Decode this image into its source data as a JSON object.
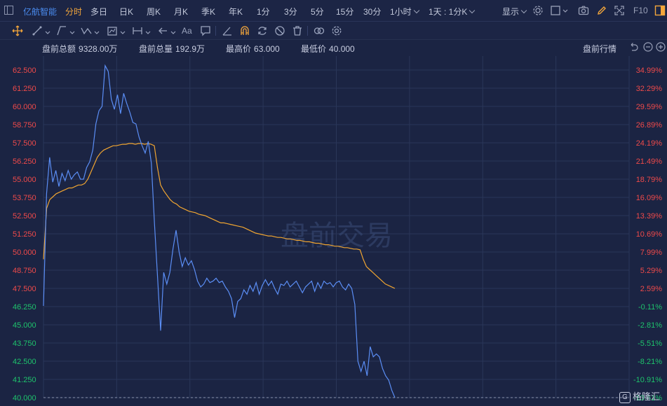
{
  "topbar": {
    "stock_name": "亿航智能",
    "periods": [
      "分时",
      "多日",
      "日K",
      "周K",
      "月K",
      "季K",
      "年K",
      "1分",
      "3分",
      "5分",
      "15分",
      "30分",
      "1小时",
      "1天 : 1分K"
    ],
    "active_period": "分时",
    "display_label": "显示",
    "f10_label": "F10"
  },
  "toolbar": {
    "text_tool_label": "Aa"
  },
  "infobar": {
    "turnover_label": "盘前总额",
    "turnover_value": "9328.00万",
    "volume_label": "盘前总量",
    "volume_value": "192.9万",
    "high_label": "最高价",
    "high_value": "63.000",
    "low_label": "最低价",
    "low_value": "40.000",
    "mode_label": "盘前行情"
  },
  "watermark": "盘前交易",
  "logo": {
    "mark": "G",
    "text": "格隆汇"
  },
  "colors": {
    "price_line": "#5b8ef5",
    "avg_line": "#f0a531",
    "up": "#ef4a4a",
    "down": "#1ec36c",
    "grid": "#2a3659"
  },
  "chart_data": {
    "type": "line",
    "left_axis_ticks": [
      "62.500",
      "61.250",
      "60.000",
      "58.750",
      "57.500",
      "56.250",
      "55.000",
      "53.750",
      "52.500",
      "51.250",
      "50.000",
      "48.750",
      "47.500",
      "46.250",
      "45.000",
      "43.750",
      "42.500",
      "41.250",
      "40.000"
    ],
    "right_axis_ticks": [
      "34.99%",
      "32.29%",
      "29.59%",
      "26.89%",
      "24.19%",
      "21.49%",
      "18.79%",
      "16.09%",
      "13.39%",
      "10.69%",
      "7.99%",
      "5.29%",
      "2.59%",
      "-0.11%",
      "-2.81%",
      "-5.51%",
      "-8.21%",
      "-10.91%",
      "-13.61%"
    ],
    "ylim": [
      40.0,
      62.5
    ],
    "reference_price": 46.3,
    "x_points": 120,
    "series": [
      {
        "role": "price",
        "values": [
          46.3,
          54.0,
          56.5,
          54.8,
          55.6,
          54.5,
          55.4,
          54.9,
          55.6,
          55.0,
          55.3,
          55.5,
          55.0,
          55.0,
          55.8,
          56.2,
          57.0,
          58.8,
          59.7,
          60.0,
          62.8,
          62.4,
          60.5,
          59.8,
          60.8,
          59.5,
          60.9,
          60.2,
          59.6,
          58.9,
          58.8,
          57.9,
          57.3,
          56.8,
          57.6,
          56.1,
          52.0,
          48.3,
          44.6,
          48.6,
          47.8,
          48.6,
          50.2,
          51.5,
          50.0,
          49.0,
          49.6,
          49.1,
          49.4,
          48.8,
          48.0,
          47.6,
          47.8,
          48.2,
          47.9,
          48.0,
          48.2,
          47.9,
          48.0,
          47.6,
          47.3,
          46.8,
          45.5,
          46.6,
          46.8,
          47.4,
          47.1,
          47.7,
          47.3,
          47.9,
          47.1,
          47.7,
          48.1,
          47.7,
          48.0,
          47.5,
          47.1,
          47.8,
          47.7,
          48.0,
          47.6,
          47.8,
          48.0,
          47.6,
          47.2,
          47.6,
          47.8,
          48.0,
          47.3,
          47.9,
          47.5,
          48.0,
          47.8,
          47.9,
          47.6,
          47.9,
          48.0,
          47.6,
          47.4,
          47.8,
          47.5,
          46.4,
          42.5,
          41.8,
          42.5,
          41.5,
          43.5,
          42.8,
          43.0,
          42.8,
          42.0,
          41.5,
          41.2,
          40.5,
          40.0
        ]
      },
      {
        "role": "average",
        "values": [
          49.5,
          53.0,
          53.6,
          53.8,
          54.0,
          54.1,
          54.2,
          54.3,
          54.4,
          54.4,
          54.5,
          54.6,
          54.6,
          54.7,
          55.0,
          55.5,
          56.0,
          56.5,
          56.8,
          57.0,
          57.1,
          57.2,
          57.3,
          57.3,
          57.35,
          57.4,
          57.4,
          57.45,
          57.45,
          57.4,
          57.45,
          57.45,
          57.4,
          57.45,
          57.4,
          57.3,
          55.8,
          54.6,
          54.2,
          53.9,
          53.6,
          53.4,
          53.3,
          53.1,
          53.0,
          52.9,
          52.8,
          52.75,
          52.7,
          52.6,
          52.55,
          52.5,
          52.4,
          52.3,
          52.2,
          52.1,
          52.0,
          52.0,
          51.95,
          51.9,
          51.85,
          51.8,
          51.75,
          51.7,
          51.6,
          51.5,
          51.4,
          51.3,
          51.25,
          51.2,
          51.15,
          51.1,
          51.1,
          51.05,
          51.0,
          51.0,
          50.95,
          50.9,
          50.9,
          50.85,
          50.8,
          50.8,
          50.75,
          50.7,
          50.7,
          50.65,
          50.6,
          50.6,
          50.55,
          50.5,
          50.5,
          50.45,
          50.4,
          50.4,
          50.35,
          50.3,
          50.3,
          50.25,
          50.2,
          50.2,
          50.15,
          49.5,
          49.0,
          48.8,
          48.6,
          48.4,
          48.2,
          48.0,
          47.8,
          47.7,
          47.6,
          47.5
        ]
      }
    ]
  }
}
